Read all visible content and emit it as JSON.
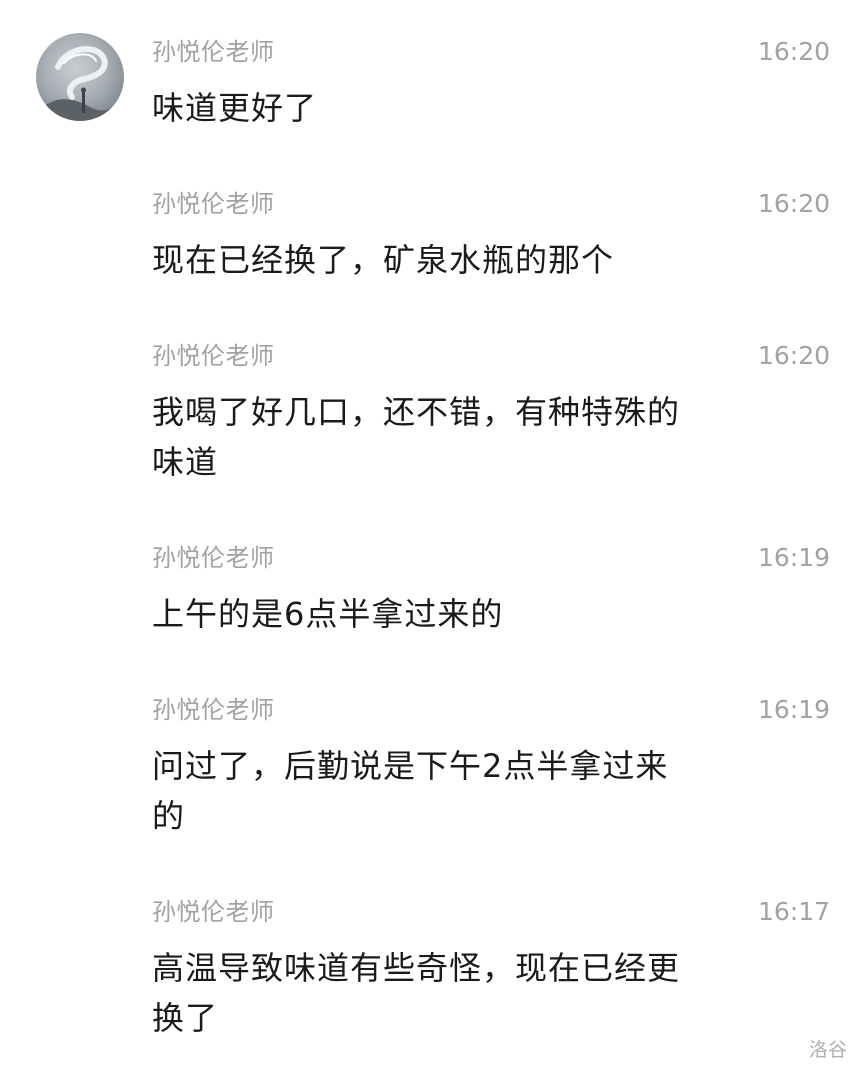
{
  "messages": [
    {
      "sender": "孙悦伦老师",
      "time": "16:20",
      "text": "味道更好了"
    },
    {
      "sender": "孙悦伦老师",
      "time": "16:20",
      "text": "现在已经换了，矿泉水瓶的那个"
    },
    {
      "sender": "孙悦伦老师",
      "time": "16:20",
      "text": "我喝了好几口，还不错，有种特殊的味道"
    },
    {
      "sender": "孙悦伦老师",
      "time": "16:19",
      "text": "上午的是6点半拿过来的"
    },
    {
      "sender": "孙悦伦老师",
      "time": "16:19",
      "text": "问过了，后勤说是下午2点半拿过来的"
    },
    {
      "sender": "孙悦伦老师",
      "time": "16:17",
      "text": "高温导致味道有些奇怪，现在已经更换了"
    }
  ],
  "watermark": "洛谷"
}
